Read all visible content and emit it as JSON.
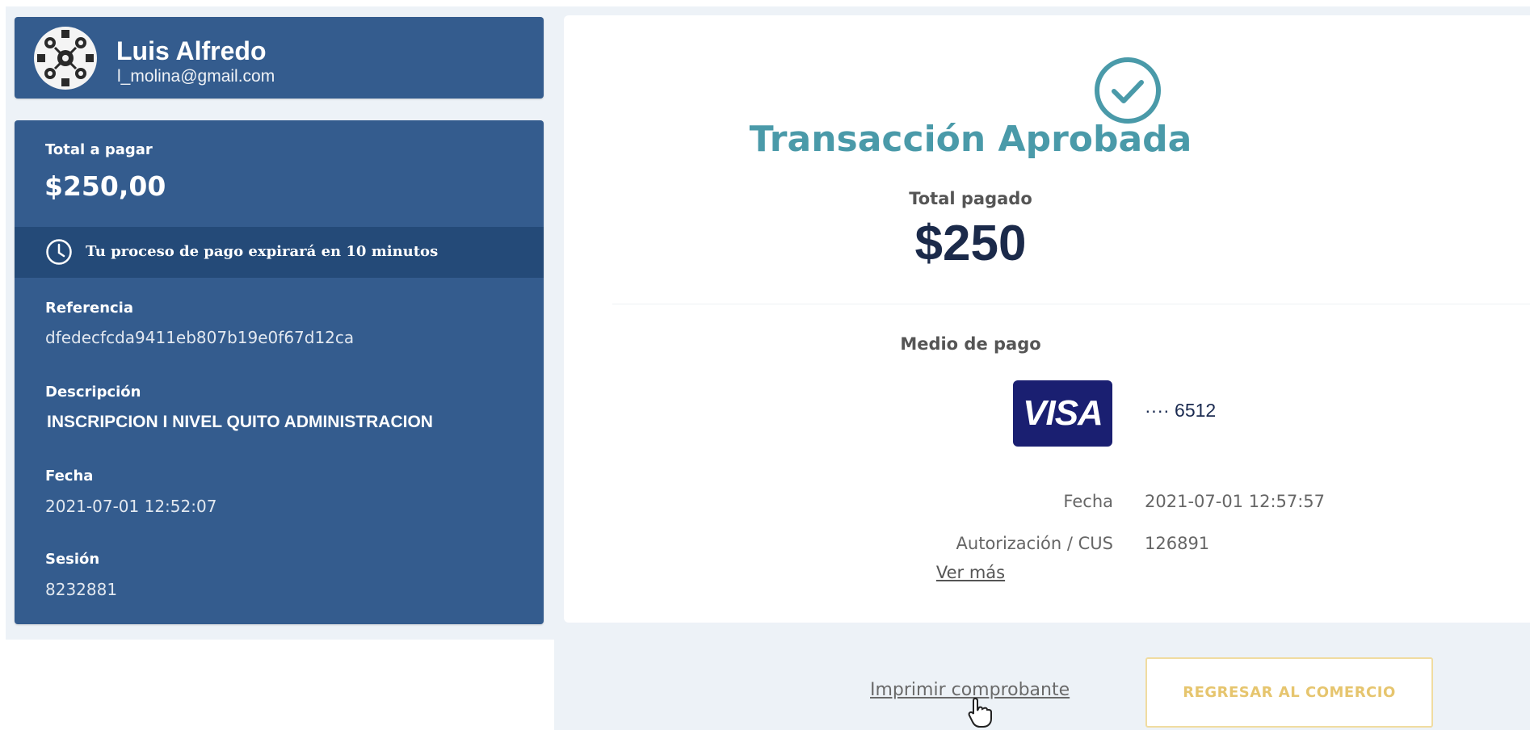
{
  "user": {
    "name": "Luis Alfredo",
    "email": "l_molina@gmail.com",
    "avatar_icon": "avatar-pattern-icon"
  },
  "payment": {
    "total_label": "Total a pagar",
    "total_value": "$250,00",
    "expire_notice": "Tu proceso de pago expirará en 10 minutos",
    "reference_label": "Referencia",
    "reference_value": "dfedecfcda9411eb807b19e0f67d12ca",
    "description_label": "Descripción",
    "description_value": "INSCRIPCION I NIVEL QUITO ADMINISTRACION",
    "date_label": "Fecha",
    "date_value": "2021-07-01 12:52:07",
    "session_label": "Sesión",
    "session_value": "8232881"
  },
  "result": {
    "status_title": "Transacción Aprobada",
    "total_paid_label": "Total pagado",
    "total_paid_value": "$250",
    "method_label": "Medio de pago",
    "card_brand": "VISA",
    "card_last4": "···· 6512",
    "date_label": "Fecha",
    "date_value": "2021-07-01 12:57:57",
    "auth_label": "Autorización / CUS",
    "auth_value": "126891",
    "more_link": "Ver más"
  },
  "actions": {
    "print_label": "Imprimir comprobante",
    "return_label": "REGRESAR AL COMERCIO"
  },
  "colors": {
    "sidebar": "#345c8e",
    "expire_bar": "#244a78",
    "success": "#4a9aa9",
    "visa": "#1a1f71",
    "return_button_text": "#e6c56e"
  }
}
